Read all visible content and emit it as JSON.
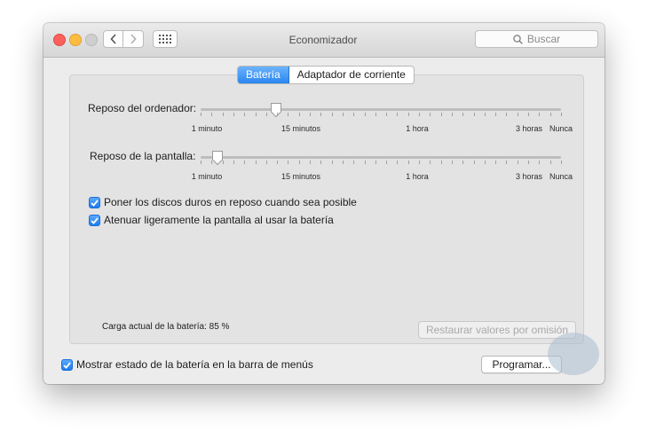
{
  "window": {
    "title": "Economizador"
  },
  "search": {
    "placeholder": "Buscar"
  },
  "tabs": [
    {
      "label": "Batería",
      "active": true
    },
    {
      "label": "Adaptador de corriente",
      "active": false
    }
  ],
  "computer_sleep": {
    "label": "Reposo del ordenador:",
    "value": "15 minutos",
    "ticks": [
      "1 minuto",
      "15 minutos",
      "1 hora",
      "3 horas",
      "Nunca"
    ]
  },
  "display_sleep": {
    "label": "Reposo de la pantalla:",
    "value": "1 minuto",
    "ticks": [
      "1 minuto",
      "15 minutos",
      "1 hora",
      "3 horas",
      "Nunca"
    ]
  },
  "options": [
    {
      "label": "Poner los discos duros en reposo cuando sea posible",
      "checked": true
    },
    {
      "label": "Atenuar ligeramente la pantalla al usar la batería",
      "checked": true
    }
  ],
  "battery": {
    "status": "Carga actual de la batería: 85 %"
  },
  "buttons": {
    "restore": "Restaurar valores por omisión",
    "schedule": "Programar..."
  },
  "footer": {
    "show_status": {
      "label": "Mostrar estado de la batería en la barra de menús",
      "checked": true
    }
  },
  "colors": {
    "accent": "#2a86f2",
    "close": "#fc605c",
    "minimize": "#fdbc40",
    "zoom_disabled": "#cfcfcf"
  },
  "icons": [
    "back-chevron-icon",
    "forward-chevron-icon",
    "show-all-grid-icon",
    "search-icon",
    "checkmark-icon"
  ]
}
